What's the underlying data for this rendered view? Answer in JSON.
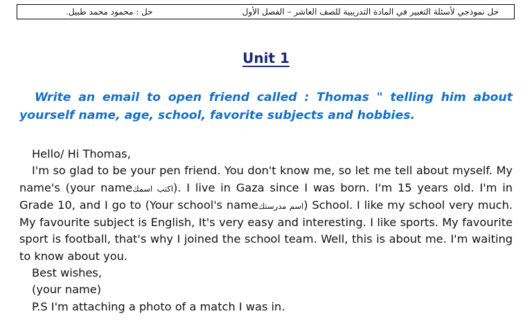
{
  "header": {
    "title": "حل نموذجي لأسئلة التعبير في المادة التدريبية للصف العاشر – الفصل الأول",
    "author": "حل : محمود محمد طبيل."
  },
  "unit_title": "Unit 1",
  "prompt": "Write an email to open friend called : Thomas \" telling him about yourself name, age, school, favorite subjects and hobbies.",
  "letter": {
    "greeting": "Hello/ Hi Thomas,",
    "p1": "I'm so glad to be your pen friend. You don't know me, so let me tell about myself. My name's (",
    "name_placeholder": "your name",
    "name_arabic": "اكتب اسمك",
    "p2": "). I live in Gaza since I was born. I'm 15 years old. I'm in Grade 10, and I go to (",
    "school_placeholder": "Your school's name",
    "school_arabic": "اسم مدرستك",
    "p3": ") School. I like my school very much. My favourite subject is English, It's very easy and interesting. I like sports. My favourite sport is football, that's why I joined the school team. Well, this is about me. I'm waiting to know about you.",
    "closing": "Best wishes,",
    "signature": "(your name)",
    "ps": "P.S I'm attaching a photo of a match I was in."
  },
  "colors": {
    "prompt_blue": "#1570c7",
    "title_navy": "#1a2a6e",
    "text": "#111111"
  }
}
